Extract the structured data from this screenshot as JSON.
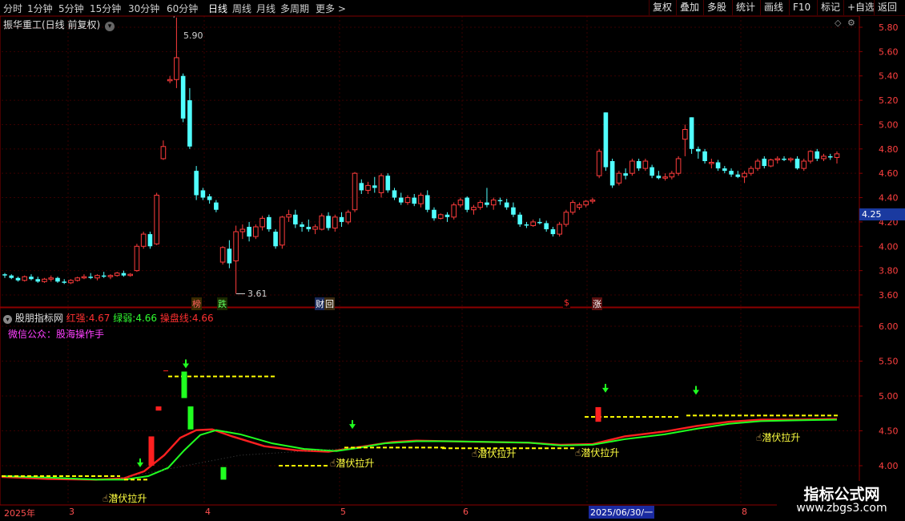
{
  "toolbar": {
    "timeframes": [
      "分时",
      "1分钟",
      "5分钟",
      "15分钟",
      "30分钟",
      "60分钟",
      "日线",
      "周线",
      "月线",
      "多周期",
      "更多"
    ],
    "active": "日线",
    "right_buttons": [
      "复权",
      "叠加",
      "多股",
      "统计",
      "画线",
      "F10",
      "标记",
      "+自选",
      "返回"
    ]
  },
  "main_header": {
    "title": "振华重工(日线 前复权)"
  },
  "price_axis": {
    "ticks": [
      "5.80",
      "5.60",
      "5.40",
      "5.20",
      "5.00",
      "4.80",
      "4.60",
      "4.40",
      "4.20",
      "4.00",
      "3.80",
      "3.60"
    ],
    "current_price": "4.25"
  },
  "annotations": {
    "high_label": "5.90",
    "low_label": "3.61",
    "event_tags": [
      {
        "text": "榜",
        "color": "#ff6060",
        "bg": "#3a2a00"
      },
      {
        "text": "跌",
        "color": "#60ff60",
        "bg": "#1a2a00"
      },
      {
        "text": "财",
        "color": "#ffffff",
        "bg": "#1a2a5a"
      },
      {
        "text": "回",
        "color": "#ffffff",
        "bg": "#3a2a10"
      },
      {
        "text": "$",
        "color": "#ff3030",
        "bg": "#000000"
      },
      {
        "text": "涨",
        "color": "#ffffff",
        "bg": "#5a1010"
      }
    ]
  },
  "indicator": {
    "name": "股朋指标网",
    "red_label": "红强:",
    "red_value": "4.67",
    "green_label": "绿弱:",
    "green_value": "4.66",
    "line_label": "操盘线:",
    "line_value": "4.66",
    "wechat": "微信公众：股海操作手",
    "ticks": [
      "6.00",
      "5.50",
      "5.00",
      "4.50",
      "4.00"
    ],
    "signal_text": "潜伏拉升"
  },
  "date_axis": {
    "labels": [
      "2025年",
      "3",
      "4",
      "5",
      "6",
      "2025/06/30/一",
      "8"
    ]
  },
  "watermark": {
    "title": "指标公式网",
    "url": "www.zbgs3.com"
  },
  "colors": {
    "up": "#ff3c3c",
    "down": "#50ffff",
    "grid": "#3a0000",
    "axis": "#8b0000",
    "indicator_red": "#ff2020",
    "indicator_green": "#20ff20",
    "dashed": "#ffff00",
    "accent": "#ffff00"
  }
}
